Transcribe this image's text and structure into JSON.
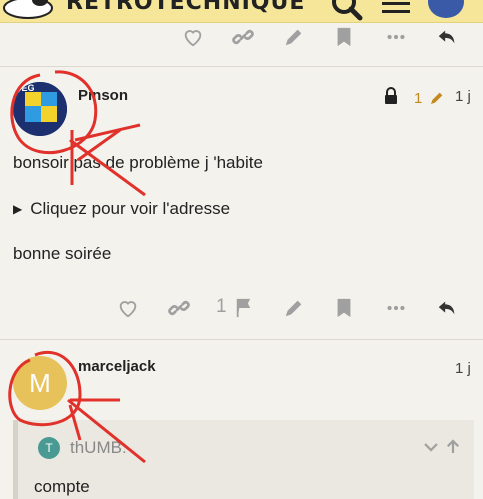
{
  "header": {
    "site_name": "RETROTECHNIQUE",
    "search_icon": "search-icon",
    "menu_icon": "hamburger-icon"
  },
  "top_actions": {
    "icons": [
      "heart-icon",
      "link-icon",
      "pencil-icon",
      "bookmark-icon",
      "more-icon",
      "reply-icon"
    ]
  },
  "post1": {
    "username": "Pinson",
    "edit_count": "1",
    "age": "1 j",
    "paragraph1": "bonsoir pas de problème j 'habite",
    "details_summary": "Cliquez pour voir l'adresse",
    "paragraph2": "bonne soirée",
    "flag_count": "1",
    "avatar_partial_text": "DEG"
  },
  "post2": {
    "username": "marceljack",
    "avatar_letter": "M",
    "age": "1 j",
    "quote": {
      "avatar_letter": "T",
      "author": "thUMB:",
      "text": "compte"
    }
  },
  "colors": {
    "header_bg": "#f6e69a",
    "page_bg": "#f4f2ec",
    "annotation_red": "#e0312a",
    "edit_orange": "#c48a1f",
    "avatar_m": "#e7c25a"
  }
}
